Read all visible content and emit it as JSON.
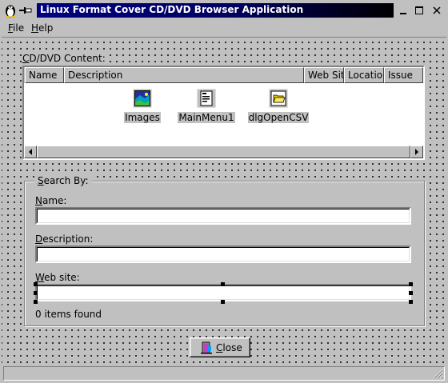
{
  "window": {
    "title": "Linux Format Cover CD/DVD Browser Application",
    "controls": [
      "minimize-icon",
      "maximize-icon",
      "close-icon"
    ]
  },
  "menubar": {
    "file_rest": "ile",
    "file_accel": "F",
    "help_rest": "elp",
    "help_accel": "H"
  },
  "content": {
    "label_accel": "C",
    "label_rest": "D/DVD Content:",
    "columns": [
      "Name",
      "Description",
      "Web Sit",
      "Location",
      "Issue"
    ],
    "items": [
      {
        "caption": "Images",
        "icon": "images-icon"
      },
      {
        "caption": "MainMenu1",
        "icon": "menu-icon"
      },
      {
        "caption": "dlgOpenCSV",
        "icon": "open-dialog-icon"
      }
    ]
  },
  "search": {
    "group_accel": "S",
    "group_rest": "earch By:",
    "name_accel": "N",
    "name_rest": "ame:",
    "name_value": "",
    "desc_accel": "D",
    "desc_rest": "escription:",
    "desc_value": "",
    "web_accel": "W",
    "web_rest": "eb site:",
    "web_value": "",
    "result": "0 items found"
  },
  "footer": {
    "close_accel": "C",
    "close_rest": "lose"
  }
}
